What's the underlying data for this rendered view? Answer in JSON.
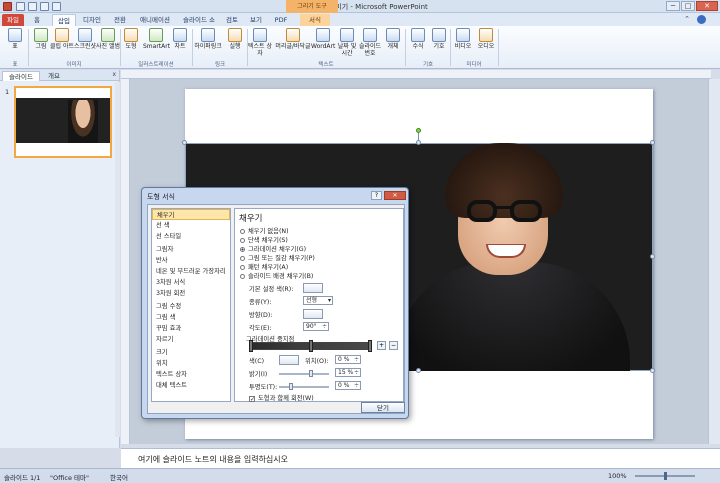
{
  "window": {
    "title": "프로필 사진 꾸미기 - Microsoft PowerPoint",
    "context_tab_group": "그리기 도구",
    "minimize": "─",
    "maximize": "□",
    "close": "✕"
  },
  "tabs": [
    {
      "label": "파일"
    },
    {
      "label": "홈"
    },
    {
      "label": "삽입"
    },
    {
      "label": "디자인"
    },
    {
      "label": "전환"
    },
    {
      "label": "애니메이션"
    },
    {
      "label": "슬라이드 쇼"
    },
    {
      "label": "검토"
    },
    {
      "label": "보기"
    },
    {
      "label": "PDF"
    },
    {
      "label": "서식"
    }
  ],
  "ribbon": {
    "buttons": [
      "표",
      "그림",
      "클립 아트",
      "스크린샷",
      "사진 앨범",
      "도형",
      "SmartArt",
      "차트",
      "하이퍼링크",
      "실행",
      "텍스트 상자",
      "머리글/바닥글",
      "WordArt",
      "날짜 및 시간",
      "슬라이드 번호",
      "개체",
      "수식",
      "기호",
      "비디오",
      "오디오"
    ],
    "groups": [
      "표",
      "이미지",
      "일러스트레이션",
      "링크",
      "텍스트",
      "기호",
      "미디어"
    ]
  },
  "left_panel": {
    "tabs": [
      "슬라이드",
      "개요"
    ],
    "close": "x",
    "slide_number": "1"
  },
  "dialog": {
    "title": "도형 서식",
    "help": "?",
    "close_x": "✕",
    "categories": [
      "채우기",
      "선 색",
      "선 스타일",
      "그림자",
      "반사",
      "네온 및 부드러운 가장자리",
      "3차원 서식",
      "3차원 회전",
      "그림 수정",
      "그림 색",
      "꾸밈 효과",
      "자르기",
      "크기",
      "위치",
      "텍스트 상자",
      "대체 텍스트"
    ],
    "panel_heading": "채우기",
    "fill_options": [
      "채우기 없음(N)",
      "단색 채우기(S)",
      "그라데이션 채우기(G)",
      "그림 또는 질감 채우기(P)",
      "패턴 채우기(A)",
      "슬라이드 배경 채우기(B)"
    ],
    "selected_fill": "그라데이션 채우기(G)",
    "preset_label": "기본 설정 색(R):",
    "type_label": "종류(Y):",
    "type_value": "선형",
    "direction_label": "방향(D):",
    "angle_label": "각도(E):",
    "angle_value": "90°",
    "stops_label": "그라데이션 중지점",
    "color_label": "색(C)",
    "position_label": "위치(O):",
    "position_value": "0 %",
    "brightness_label": "밝기(I)",
    "brightness_value": "15 %",
    "transparency_label": "투명도(T):",
    "transparency_value": "0 %",
    "rotate_check": "도형과 함께 회전(W)",
    "close_button": "닫기"
  },
  "notes": {
    "placeholder": "여기에 슬라이드 노트의 내용을 입력하십시오"
  },
  "status": {
    "slide_info": "슬라이드 1/1",
    "theme": "\"Office 테마\"",
    "language": "한국어",
    "zoom": "100%"
  }
}
